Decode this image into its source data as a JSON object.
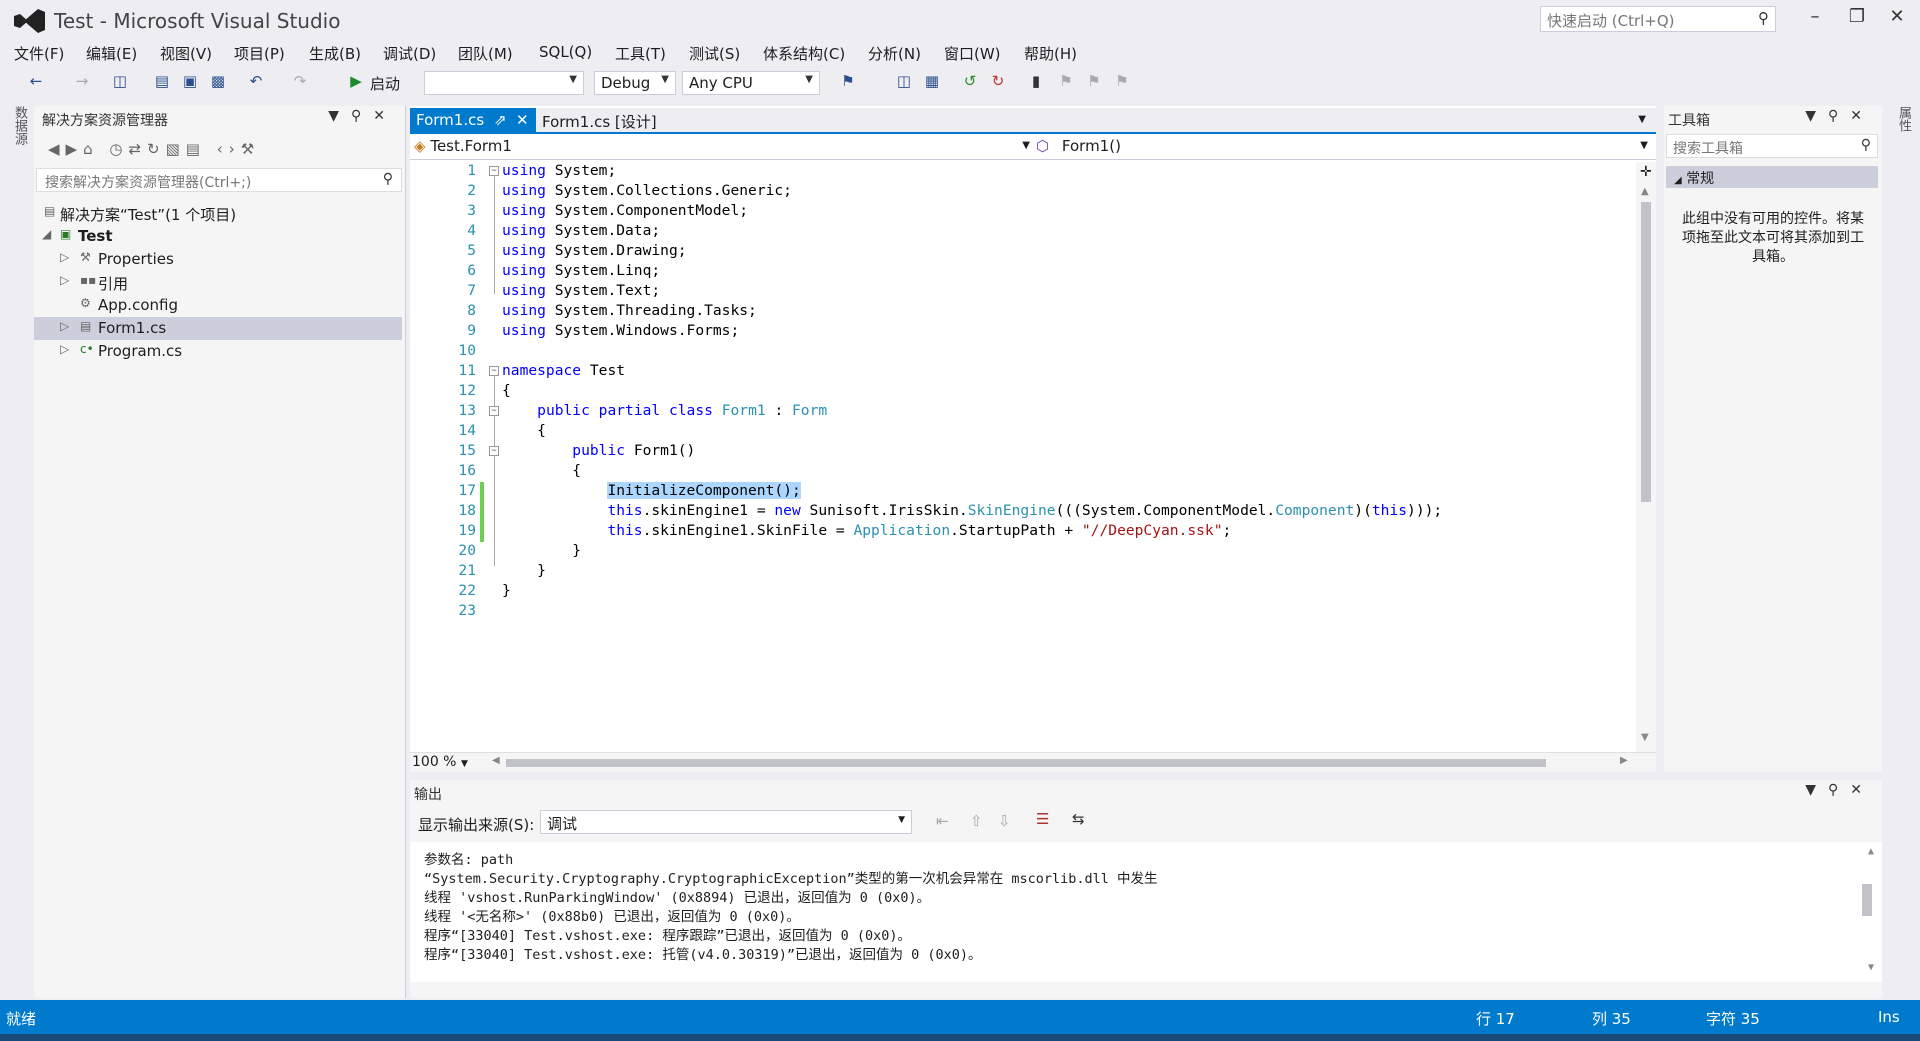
{
  "window": {
    "title": "Test - Microsoft Visual Studio",
    "quick_launch_placeholder": "快速启动 (Ctrl+Q)"
  },
  "menu": [
    "文件(F)",
    "编辑(E)",
    "视图(V)",
    "项目(P)",
    "生成(B)",
    "调试(D)",
    "团队(M)",
    "SQL(Q)",
    "工具(T)",
    "测试(S)",
    "体系结构(C)",
    "分析(N)",
    "窗口(W)",
    "帮助(H)"
  ],
  "toolbar": {
    "start_label": "启动",
    "config": "Debug",
    "platform": "Any CPU"
  },
  "left_strip_label": "数据源",
  "right_strip_label": "属性",
  "solution_explorer": {
    "title": "解决方案资源管理器",
    "search_placeholder": "搜索解决方案资源管理器(Ctrl+;)",
    "items": [
      {
        "label": "解决方案“Test”(1 个项目)",
        "icon": "solution-icon"
      },
      {
        "label": "Test",
        "icon": "csharp-project-icon"
      },
      {
        "label": "Properties",
        "icon": "wrench-icon"
      },
      {
        "label": "引用",
        "icon": "references-icon"
      },
      {
        "label": "App.config",
        "icon": "config-icon"
      },
      {
        "label": "Form1.cs",
        "icon": "form-icon",
        "selected": true
      },
      {
        "label": "Program.cs",
        "icon": "csharp-file-icon"
      }
    ]
  },
  "editor": {
    "tabs": [
      {
        "label": "Form1.cs",
        "active": true
      },
      {
        "label": "Form1.cs [设计]",
        "active": false
      }
    ],
    "nav_left": "Test.Form1",
    "nav_right": "Form1()",
    "zoom": "100 %",
    "line_numbers": [
      "1",
      "2",
      "3",
      "4",
      "5",
      "6",
      "7",
      "8",
      "9",
      "10",
      "11",
      "12",
      "13",
      "14",
      "15",
      "16",
      "17",
      "18",
      "19",
      "20",
      "21",
      "22",
      "23"
    ],
    "code": {
      "l1": "System;",
      "l2": "System.Collections.Generic;",
      "l3": "System.ComponentModel;",
      "l4": "System.Data;",
      "l5": "System.Drawing;",
      "l6": "System.Linq;",
      "l7": "System.Text;",
      "l8": "System.Threading.Tasks;",
      "l9": "System.Windows.Forms;",
      "kw_using": "using",
      "kw_namespace": "namespace",
      "ns": "Test",
      "kw_public": "public",
      "kw_partial": "partial",
      "kw_class": "class",
      "cls": "Form1",
      "colon": " : ",
      "base": "Form",
      "ctor": "Form1()",
      "l17": "InitializeComponent();",
      "kw_this": "this",
      "kw_new": "new",
      "l18a": ".skinEngine1 = ",
      "l18b": " Sunisoft.IrisSkin.",
      "l18c": "SkinEngine",
      "l18d": "(((System.ComponentModel.",
      "l18e": "Component",
      ")": ")",
      "l18f": "(",
      "l18g": ")));",
      "l19a": ".skinEngine1.SkinFile = ",
      "l19b": "Application",
      "l19c": ".StartupPath + ",
      "l19d": "\"//DeepCyan.ssk\"",
      "l19e": ";",
      "ob": "{",
      "cb": "}"
    }
  },
  "toolbox": {
    "title": "工具箱",
    "search_placeholder": "搜索工具箱",
    "group": "常规",
    "empty_text": "此组中没有可用的控件。将某项拖至此文本可将其添加到工具箱。"
  },
  "output": {
    "title": "输出",
    "source_label": "显示输出来源(S):",
    "source_value": "调试",
    "lines": [
      "参数名: path",
      "“System.Security.Cryptography.CryptographicException”类型的第一次机会异常在 mscorlib.dll 中发生",
      "线程 'vshost.RunParkingWindow' (0x8894) 已退出，返回值为 0 (0x0)。",
      "线程 '<无名称>' (0x88b0) 已退出，返回值为 0 (0x0)。",
      "程序“[33040] Test.vshost.exe: 程序跟踪”已退出，返回值为 0 (0x0)。",
      "程序“[33040] Test.vshost.exe: 托管(v4.0.30319)”已退出，返回值为 0 (0x0)。"
    ]
  },
  "status": {
    "ready": "就绪",
    "line": "行 17",
    "col": "列 35",
    "char": "字符 35",
    "mode": "Ins"
  },
  "colors": {
    "accent": "#007acc",
    "keyword": "#0000ff",
    "type": "#2b91af",
    "string": "#a31515"
  }
}
